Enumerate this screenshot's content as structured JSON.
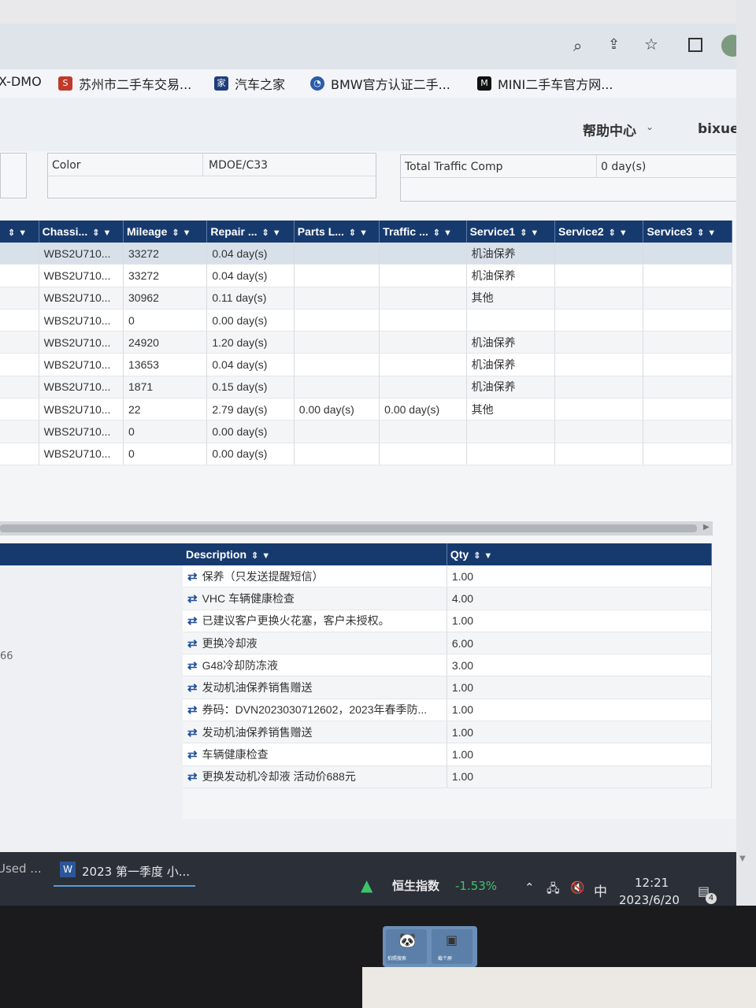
{
  "browser": {
    "toolbar_icons": [
      "zoom-icon",
      "share-icon",
      "star-icon",
      "sidebar-icon",
      "profile-avatar"
    ],
    "bookmarks": [
      {
        "label": "X-DMO",
        "icon": ""
      },
      {
        "label": "苏州市二手车交易...",
        "icon": "link-icon"
      },
      {
        "label": "汽车之家",
        "icon": "autohome-icon"
      },
      {
        "label": "BMW官方认证二手...",
        "icon": "bmw-icon"
      },
      {
        "label": "MINI二手车官方网...",
        "icon": "mini-icon"
      }
    ]
  },
  "header": {
    "help_center": "帮助中心",
    "user": "bixue.du"
  },
  "details": {
    "color_label": "Color",
    "color_value": "MDOE/C33",
    "traffic_label": "Total Traffic Comp",
    "traffic_value": "0 day(s)"
  },
  "grid1": {
    "columns": [
      "Chassi...",
      "Mileage",
      "Repair ...",
      "Parts L...",
      "Traffic ...",
      "Service1",
      "Service2",
      "Service3"
    ],
    "rows": [
      {
        "chassis": "WBS2U710...",
        "mileage": "33272",
        "repair": "0.04 day(s)",
        "parts": "",
        "traffic": "",
        "service1": "机油保养",
        "service2": "",
        "service3": ""
      },
      {
        "chassis": "WBS2U710...",
        "mileage": "33272",
        "repair": "0.04 day(s)",
        "parts": "",
        "traffic": "",
        "service1": "机油保养",
        "service2": "",
        "service3": ""
      },
      {
        "chassis": "WBS2U710...",
        "mileage": "30962",
        "repair": "0.11 day(s)",
        "parts": "",
        "traffic": "",
        "service1": "其他",
        "service2": "",
        "service3": ""
      },
      {
        "chassis": "WBS2U710...",
        "mileage": "0",
        "repair": "0.00 day(s)",
        "parts": "",
        "traffic": "",
        "service1": "",
        "service2": "",
        "service3": ""
      },
      {
        "chassis": "WBS2U710...",
        "mileage": "24920",
        "repair": "1.20 day(s)",
        "parts": "",
        "traffic": "",
        "service1": "机油保养",
        "service2": "",
        "service3": ""
      },
      {
        "chassis": "WBS2U710...",
        "mileage": "13653",
        "repair": "0.04 day(s)",
        "parts": "",
        "traffic": "",
        "service1": "机油保养",
        "service2": "",
        "service3": ""
      },
      {
        "chassis": "WBS2U710...",
        "mileage": "1871",
        "repair": "0.15 day(s)",
        "parts": "",
        "traffic": "",
        "service1": "机油保养",
        "service2": "",
        "service3": ""
      },
      {
        "chassis": "WBS2U710...",
        "mileage": "22",
        "repair": "2.79 day(s)",
        "parts": "0.00 day(s)",
        "traffic": "0.00 day(s)",
        "service1": "其他",
        "service2": "",
        "service3": ""
      },
      {
        "chassis": "WBS2U710...",
        "mileage": "0",
        "repair": "0.00 day(s)",
        "parts": "",
        "traffic": "",
        "service1": "",
        "service2": "",
        "service3": ""
      },
      {
        "chassis": "WBS2U710...",
        "mileage": "0",
        "repair": "0.00 day(s)",
        "parts": "",
        "traffic": "",
        "service1": "",
        "service2": "",
        "service3": ""
      }
    ]
  },
  "grid2": {
    "columns": [
      "Description",
      "Qty"
    ],
    "left_partial": "66",
    "rows": [
      {
        "description": "保养（只发送提醒短信）",
        "qty": "1.00"
      },
      {
        "description": "VHC 车辆健康检查",
        "qty": "4.00"
      },
      {
        "description": "已建议客户更换火花塞，客户未授权。",
        "qty": "1.00"
      },
      {
        "description": "更换冷却液",
        "qty": "6.00"
      },
      {
        "description": "G48冷却防冻液",
        "qty": "3.00"
      },
      {
        "description": "发动机油保养销售赠送",
        "qty": "1.00"
      },
      {
        "description": "券码：DVN2023030712602，2023年春季防...",
        "qty": "1.00"
      },
      {
        "description": "发动机油保养销售赠送",
        "qty": "1.00"
      },
      {
        "description": "车辆健康检查",
        "qty": "1.00"
      },
      {
        "description": "更换发动机冷却液 活动价688元",
        "qty": "1.00"
      }
    ]
  },
  "taskbar": {
    "item_partial": "Used ...",
    "word_item": "2023 第一季度 小...",
    "stock_name": "恒生指数",
    "stock_change": "-1.53%",
    "ime": "中",
    "time": "12:21",
    "date": "2023/6/20",
    "notifications": "4"
  },
  "dock": {
    "items": [
      "拍照搜索",
      "截个屏"
    ]
  }
}
